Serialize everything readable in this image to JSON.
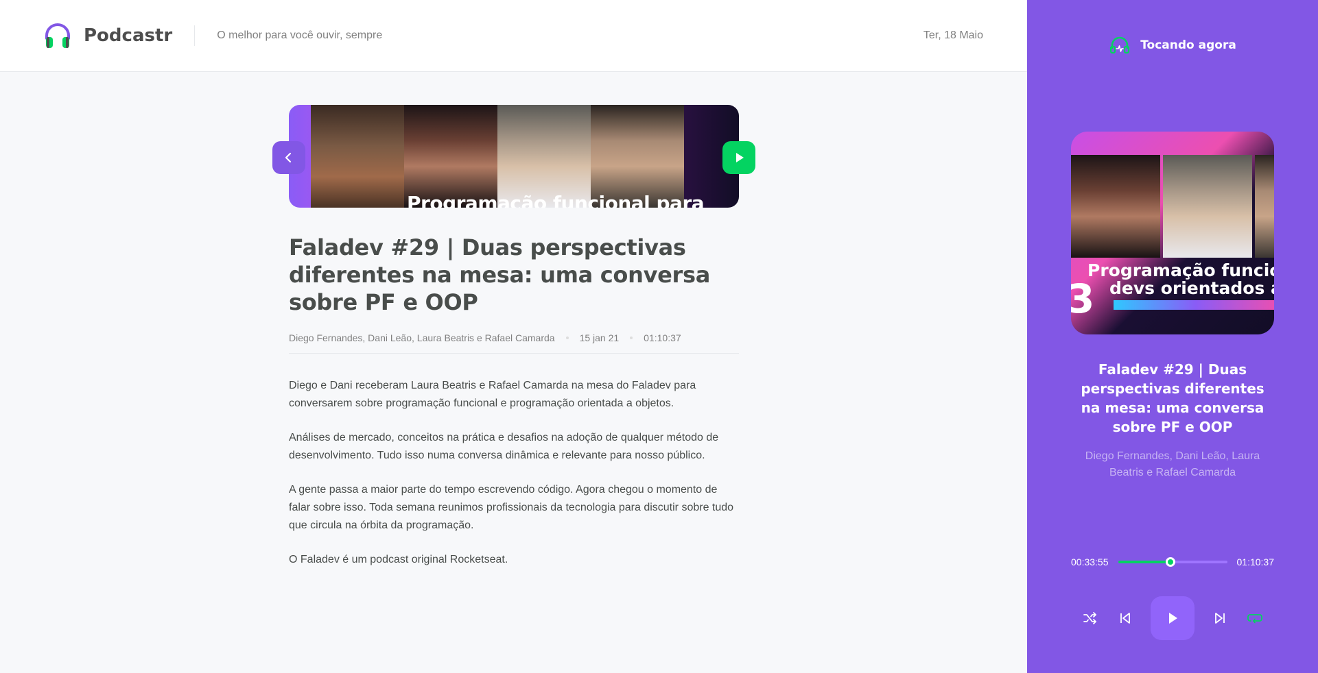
{
  "header": {
    "logo_text": "Podcastr",
    "tagline": "O melhor para você ouvir, sempre",
    "date": "Ter, 18 Maio"
  },
  "episode": {
    "thumbnail_caption": "Programação funcional para",
    "title": "Faladev #29 | Duas perspectivas diferentes na mesa: uma conversa sobre PF e OOP",
    "members": "Diego Fernandes, Dani Leão, Laura Beatris e Rafael Camarda",
    "published_at": "15 jan 21",
    "duration": "01:10:37",
    "description": [
      "Diego e Dani receberam Laura Beatris e Rafael Camarda na mesa do Faladev para conversarem sobre programação funcional e programação orientada a objetos.",
      "Análises de mercado, conceitos na prática e desafios na adoção de qualquer método de desenvolvimento. Tudo isso numa conversa dinâmica e relevante para nosso público.",
      "A gente passa a maior parte do tempo escrevendo código. Agora chegou o momento de falar sobre isso. Toda semana reunimos profissionais da tecnologia para discutir sobre tudo que circula na órbita da programação.",
      "O Faladev é um podcast original Rocketseat."
    ]
  },
  "player": {
    "heading": "Tocando agora",
    "cover_caption_line1": "Programação funcion",
    "cover_caption_line2": "devs orientados a o",
    "cover_number": "3",
    "title": "Faladev #29 | Duas perspectivas diferentes na mesa: uma conversa sobre PF e OOP",
    "members": "Diego Fernandes, Dani Leão, Laura Beatris e Rafael Camarda",
    "current_time": "00:33:55",
    "total_time": "01:10:37",
    "progress_fraction": 0.48
  },
  "colors": {
    "brand_purple": "#8257e5",
    "accent_green": "#04d361"
  },
  "icons": {
    "back": "arrow-left-icon",
    "play": "play-icon",
    "shuffle": "shuffle-icon",
    "previous": "previous-icon",
    "next": "next-icon",
    "repeat": "repeat-icon",
    "playing_now": "playing-now-icon"
  }
}
